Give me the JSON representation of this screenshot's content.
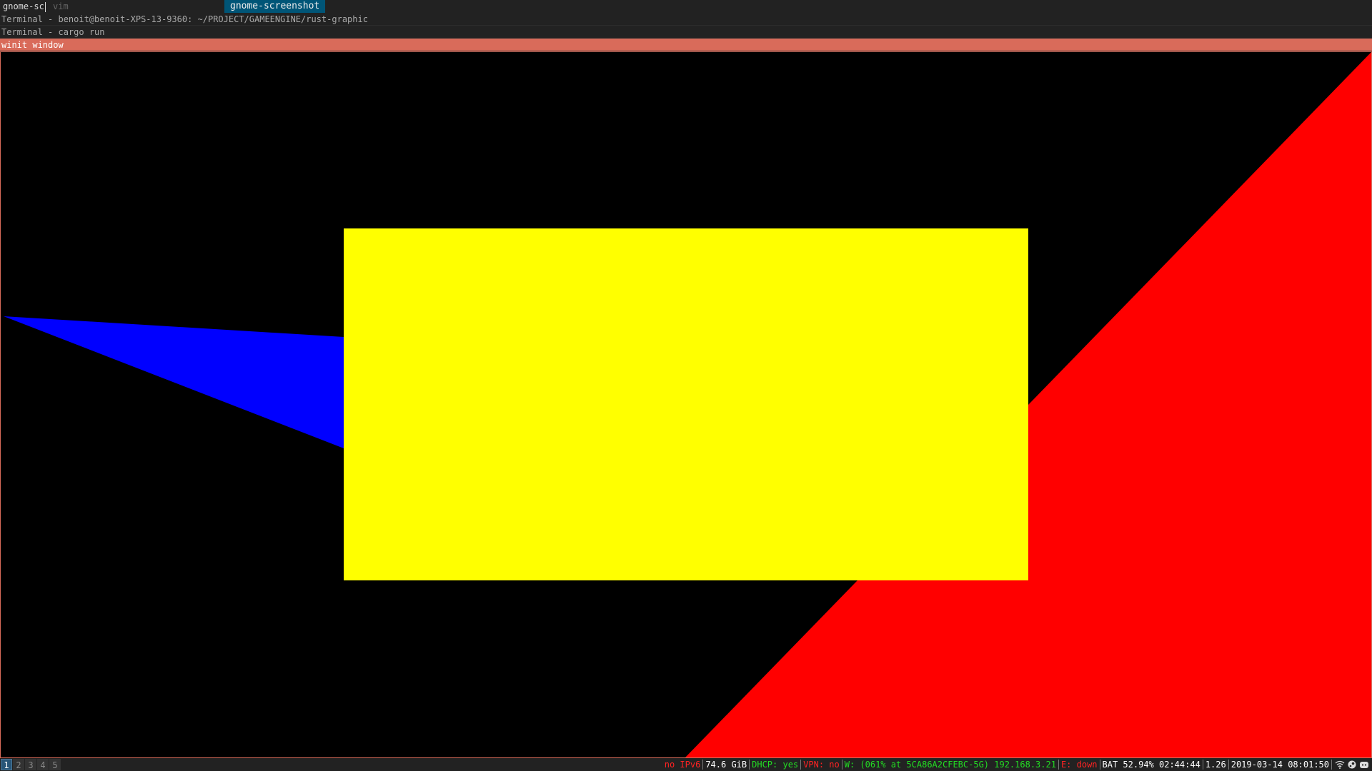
{
  "dmenu": {
    "input": "gnome-sc",
    "previous_item": "vim",
    "selected_item": "gnome-screenshot"
  },
  "windows": {
    "terminal_1": "Terminal - benoit@benoit-XPS-13-9360: ~/PROJECT/GAMEENGINE/rust-graphic",
    "terminal_2": "Terminal - cargo run",
    "winit": "winit window"
  },
  "scene": {
    "background": "#000000",
    "shapes": [
      {
        "name": "blue-triangle",
        "color": "#0000ff"
      },
      {
        "name": "red-triangle",
        "color": "#ff0000"
      },
      {
        "name": "yellow-rectangle",
        "color": "#ffff00"
      }
    ]
  },
  "statusbar": {
    "workspaces": [
      "1",
      "2",
      "3",
      "4",
      "5"
    ],
    "active_workspace": "1",
    "ipv6": "no IPv6",
    "disk": "74.6 GiB",
    "dhcp": "DHCP: yes",
    "vpn": "VPN: no",
    "wireless": "W: (061% at 5CA86A2CFEBC-5G) 192.168.3.21",
    "ethernet": "E: down",
    "battery": "BAT 52.94% 02:44:44",
    "load": "1.26",
    "datetime": "2019-03-14 08:01:50",
    "tray_icons": [
      "wifi-icon",
      "steam-icon",
      "discord-icon"
    ]
  }
}
